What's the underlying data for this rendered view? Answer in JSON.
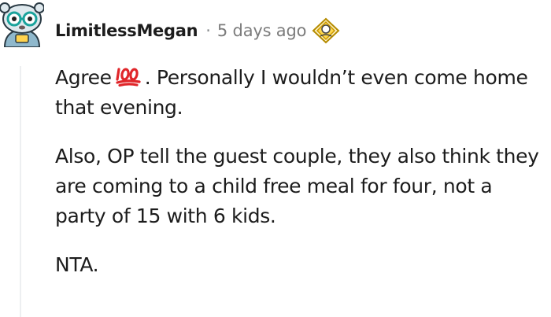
{
  "comment": {
    "author": "LimitlessMegan",
    "separator": "·",
    "timestamp": "5 days ago",
    "award_icon": "helpful-award-icon",
    "avatar_icon": "snoo-avatar-icon",
    "body": {
      "p1_before_emoji": "Agree",
      "p1_emoji": "hundred-points-emoji",
      "p1_after_emoji": ". Personally I wouldn’t even come home that evening.",
      "p2": "Also, OP tell the guest couple, they also think they are coming to a child free meal for four, not a party of 15 with 6 kids.",
      "p3": "NTA."
    }
  }
}
